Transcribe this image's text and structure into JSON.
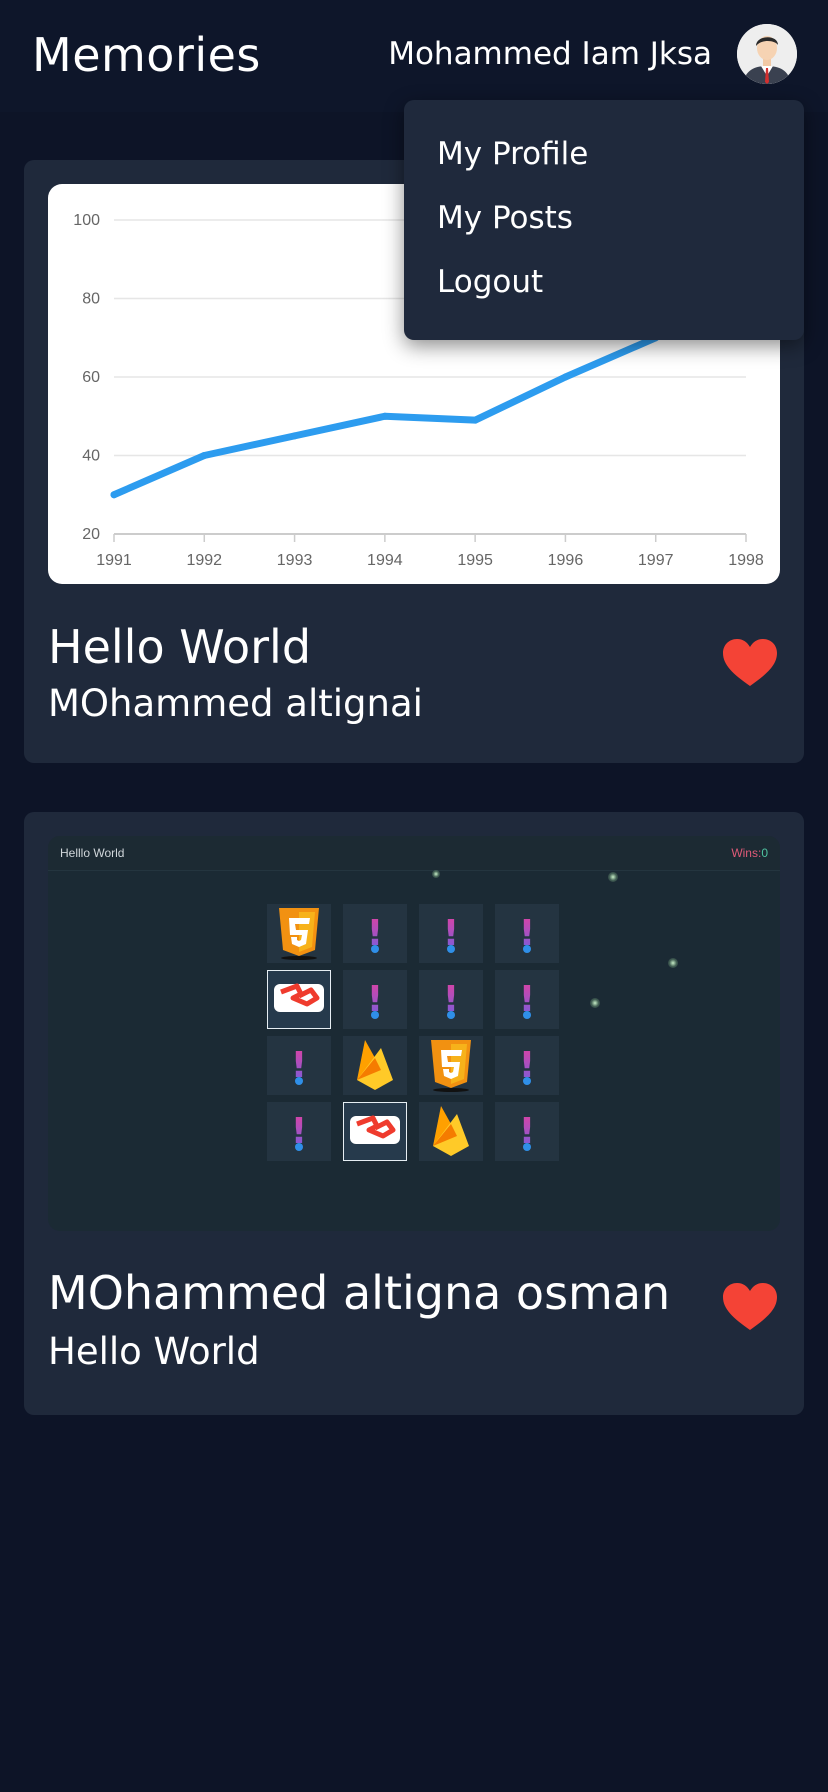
{
  "header": {
    "title": "Memories",
    "user_name": "Mohammed Iam Jksa"
  },
  "menu": {
    "items": [
      "My Profile",
      "My Posts",
      "Logout"
    ]
  },
  "posts": [
    {
      "title": "Hello World",
      "subtitle": "MOhammed altignai",
      "liked": true,
      "image": "line-chart"
    },
    {
      "title": "MOhammed altigna osman",
      "subtitle": "Hello World",
      "liked": true,
      "image": "memory-game"
    }
  ],
  "chart_data": {
    "type": "line",
    "x": [
      1991,
      1992,
      1993,
      1994,
      1995,
      1996,
      1997
    ],
    "values": [
      30,
      40,
      45,
      50,
      49,
      60,
      70
    ],
    "x_ticks": [
      "1991",
      "1992",
      "1993",
      "1994",
      "1995",
      "1996",
      "1997",
      "1998"
    ],
    "y_ticks": [
      "20",
      "40",
      "60",
      "80",
      "100"
    ],
    "xlim": [
      1991,
      1998
    ],
    "ylim": [
      20,
      100
    ],
    "grid": true,
    "line_color": "#2d9cef"
  },
  "game": {
    "title": "Helllo World",
    "wins_label": "Wins:",
    "wins_value": "0",
    "tiles": [
      [
        "html5-icon",
        "hidden",
        "hidden",
        "hidden"
      ],
      [
        "laravel-icon-selected",
        "hidden",
        "hidden",
        "hidden"
      ],
      [
        "hidden",
        "firebase-icon",
        "html5-icon",
        "hidden"
      ],
      [
        "hidden",
        "laravel-icon-selected",
        "firebase-icon",
        "hidden"
      ]
    ]
  },
  "colors": {
    "background": "#0d1427",
    "card": "#1f293b",
    "heart": "#f44336",
    "accent_line": "#2d9cef"
  }
}
